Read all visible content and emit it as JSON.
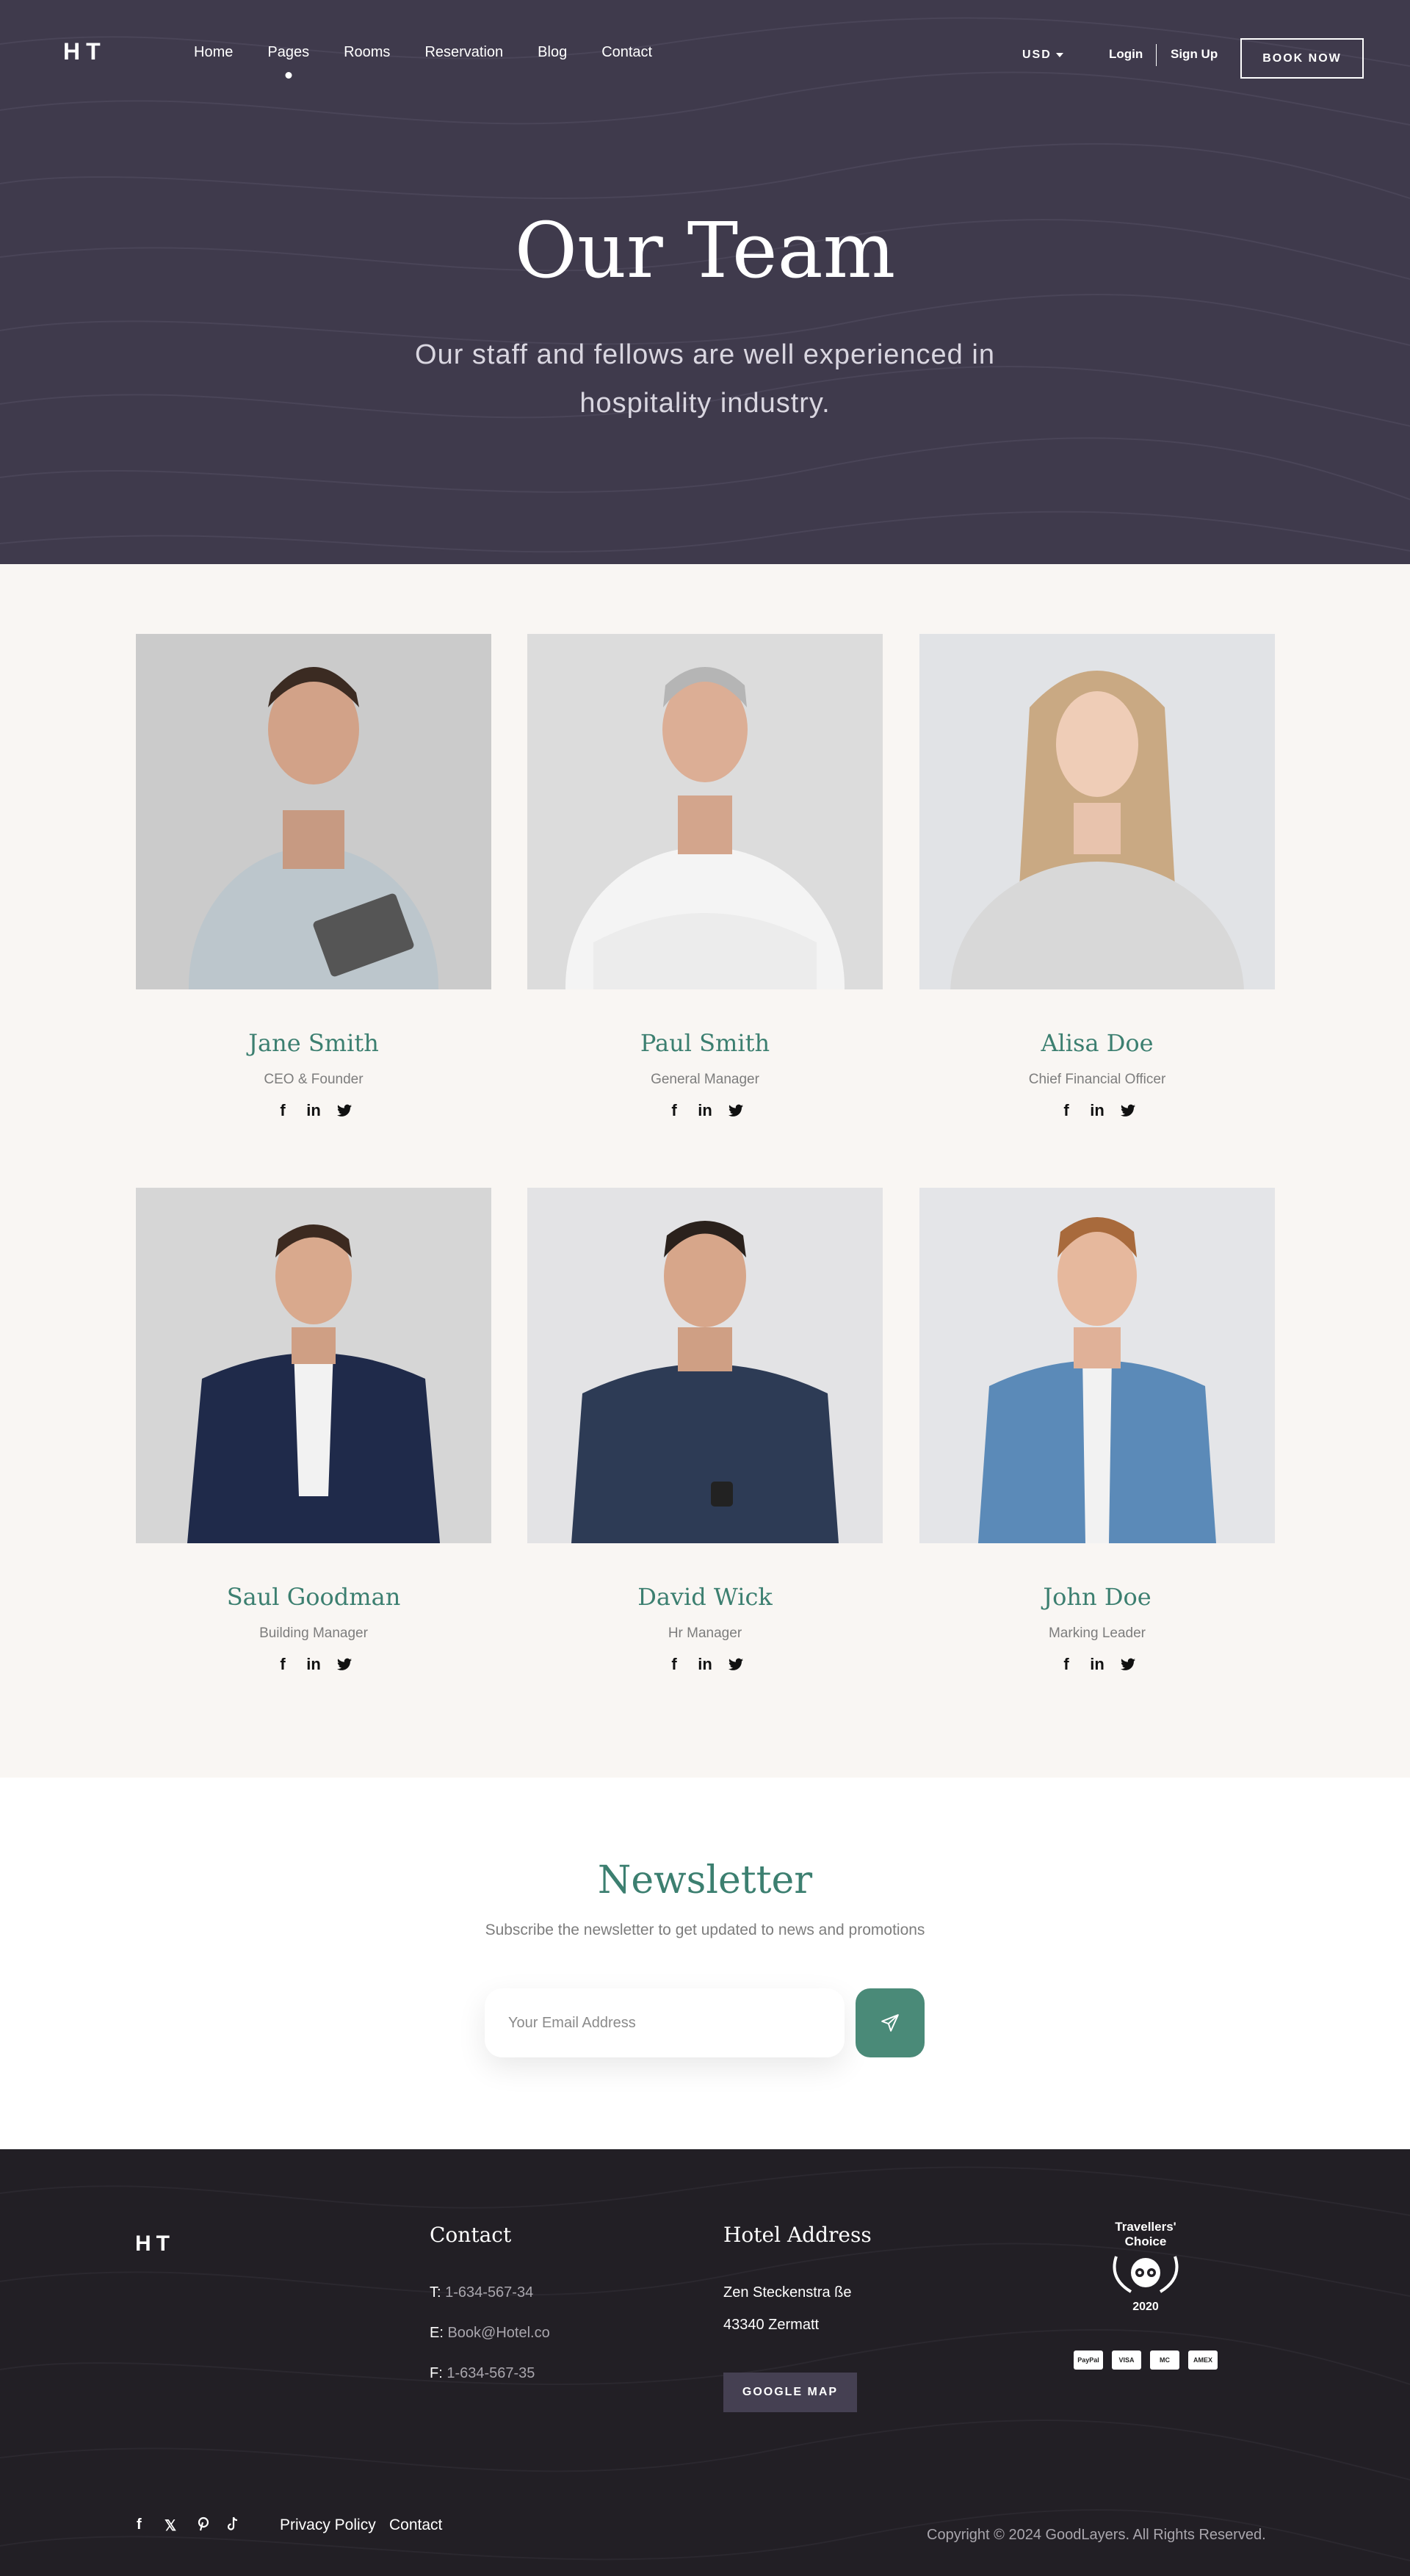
{
  "header": {
    "logo": "HT",
    "menu": [
      "Home",
      "Pages",
      "Rooms",
      "Reservation",
      "Blog",
      "Contact"
    ],
    "active_menu": "Pages",
    "currency": "USD",
    "login": "Login",
    "signup": "Sign Up",
    "book_now": "BOOK NOW"
  },
  "hero": {
    "title": "Our Team",
    "subtitle": "Our staff and fellows are well experienced in hospitality industry."
  },
  "team": [
    {
      "name": "Jane Smith",
      "role": "CEO & Founder"
    },
    {
      "name": "Paul Smith",
      "role": "General Manager"
    },
    {
      "name": "Alisa Doe",
      "role": "Chief Financial Officer"
    },
    {
      "name": "Saul Goodman",
      "role": "Building Manager"
    },
    {
      "name": "David Wick",
      "role": "Hr Manager"
    },
    {
      "name": "John Doe",
      "role": "Marking Leader"
    }
  ],
  "social_icons": [
    "facebook-icon",
    "linkedin-icon",
    "twitter-icon"
  ],
  "newsletter": {
    "title": "Newsletter",
    "subtitle": "Subscribe the newsletter to get updated to news and promotions",
    "placeholder": "Your Email Address"
  },
  "footer": {
    "logo": "HT",
    "contact_title": "Contact",
    "phone_label": "T:",
    "phone": "1-634-567-34",
    "email_label": "E:",
    "email": "Book@Hotel.co",
    "fax_label": "F:",
    "fax": "1-634-567-35",
    "address_title": "Hotel Address",
    "address_line1": "Zen Steckenstra ße",
    "address_line2": "43340 Zermatt",
    "google_map": "GOOGLE MAP",
    "award_line1": "Travellers'",
    "award_line2": "Choice",
    "award_year": "2020",
    "payment_cards": [
      "PayPal",
      "VISA",
      "MC",
      "AMEX"
    ],
    "links": [
      "Privacy Policy",
      "Contact"
    ],
    "copyright": "Copyright © 2024 GoodLayers. All Rights Reserved."
  },
  "colors": {
    "hero_bg": "#3f3a4c",
    "accent_green": "#3c7f70",
    "team_bg": "#f9f6f3",
    "footer_bg": "#221f25"
  }
}
